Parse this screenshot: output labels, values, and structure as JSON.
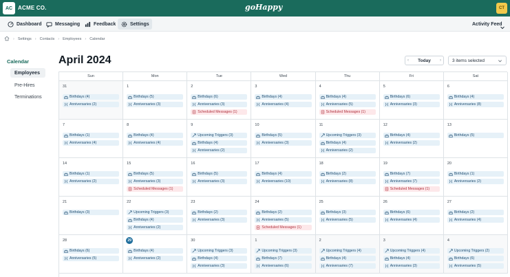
{
  "org": {
    "badge": "AC",
    "name": "ACME CO."
  },
  "brand": "goHappy",
  "user": {
    "initials": "CT"
  },
  "nav": {
    "items": [
      {
        "name": "dashboard",
        "label": "Dashboard",
        "icon": "dashboard-icon"
      },
      {
        "name": "messaging",
        "label": "Messaging",
        "icon": "message-icon"
      },
      {
        "name": "feedback",
        "label": "Feedback",
        "icon": "chart-icon"
      },
      {
        "name": "settings",
        "label": "Settings",
        "icon": "gear-icon",
        "active": true
      }
    ],
    "activity_feed": "Activity Feed"
  },
  "breadcrumbs": [
    "Settings",
    "Contacts",
    "Employees",
    "Calendar"
  ],
  "sidebar": {
    "title": "Calendar",
    "items": [
      {
        "label": "Employees",
        "active": true
      },
      {
        "label": "Pre-Hires"
      },
      {
        "label": "Terminations"
      }
    ]
  },
  "calendar": {
    "title": "April 2024",
    "today_label": "Today",
    "prev_glyph": "‹",
    "next_glyph": "›",
    "filter_label": "3 items selected",
    "weekdays": [
      "Sun",
      "Mon",
      "Tue",
      "Wed",
      "Thu",
      "Fri",
      "Sat"
    ],
    "weeks": [
      [
        {
          "day": "31",
          "outside": true,
          "events": [
            {
              "type": "birthdays",
              "label": "Birthdays (4)"
            },
            {
              "type": "anniversaries",
              "label": "Anniversaries (2)"
            }
          ]
        },
        {
          "day": "1",
          "events": [
            {
              "type": "birthdays",
              "label": "Birthdays (5)"
            },
            {
              "type": "anniversaries",
              "label": "Anniversaries (3)"
            }
          ]
        },
        {
          "day": "2",
          "events": [
            {
              "type": "birthdays",
              "label": "Birthdays (6)"
            },
            {
              "type": "anniversaries",
              "label": "Anniversaries (3)"
            },
            {
              "type": "scheduled",
              "label": "Scheduled Messages (1)"
            }
          ]
        },
        {
          "day": "3",
          "events": [
            {
              "type": "birthdays",
              "label": "Birthdays (4)"
            },
            {
              "type": "anniversaries",
              "label": "Anniversaries (4)"
            }
          ]
        },
        {
          "day": "4",
          "events": [
            {
              "type": "birthdays",
              "label": "Birthdays (4)"
            },
            {
              "type": "anniversaries",
              "label": "Anniversaries (5)"
            },
            {
              "type": "scheduled",
              "label": "Scheduled Messages (1)"
            }
          ]
        },
        {
          "day": "5",
          "events": [
            {
              "type": "birthdays",
              "label": "Birthdays (6)"
            },
            {
              "type": "anniversaries",
              "label": "Anniversaries (3)"
            }
          ]
        },
        {
          "day": "6",
          "events": [
            {
              "type": "birthdays",
              "label": "Birthdays (4)"
            },
            {
              "type": "anniversaries",
              "label": "Anniversaries (8)"
            }
          ]
        }
      ],
      [
        {
          "day": "7",
          "events": [
            {
              "type": "birthdays",
              "label": "Birthdays (1)"
            },
            {
              "type": "anniversaries",
              "label": "Anniversaries (4)"
            }
          ]
        },
        {
          "day": "8",
          "events": [
            {
              "type": "birthdays",
              "label": "Birthdays (4)"
            },
            {
              "type": "anniversaries",
              "label": "Anniversaries (4)"
            }
          ]
        },
        {
          "day": "9",
          "events": [
            {
              "type": "triggers",
              "label": "Upcoming Triggers (3)"
            },
            {
              "type": "birthdays",
              "label": "Birthdays (4)"
            },
            {
              "type": "anniversaries",
              "label": "Anniversaries (2)"
            }
          ]
        },
        {
          "day": "10",
          "events": [
            {
              "type": "birthdays",
              "label": "Birthdays (5)"
            },
            {
              "type": "anniversaries",
              "label": "Anniversaries (3)"
            }
          ]
        },
        {
          "day": "11",
          "events": [
            {
              "type": "triggers",
              "label": "Upcoming Triggers (3)"
            },
            {
              "type": "birthdays",
              "label": "Birthdays (4)"
            },
            {
              "type": "anniversaries",
              "label": "Anniversaries (2)"
            }
          ]
        },
        {
          "day": "12",
          "events": [
            {
              "type": "birthdays",
              "label": "Birthdays (4)"
            },
            {
              "type": "anniversaries",
              "label": "Anniversaries (2)"
            }
          ]
        },
        {
          "day": "13",
          "events": [
            {
              "type": "birthdays",
              "label": "Birthdays (5)"
            }
          ]
        }
      ],
      [
        {
          "day": "14",
          "events": [
            {
              "type": "birthdays",
              "label": "Birthdays (1)"
            },
            {
              "type": "anniversaries",
              "label": "Anniversaries (2)"
            }
          ]
        },
        {
          "day": "15",
          "events": [
            {
              "type": "birthdays",
              "label": "Birthdays (5)"
            },
            {
              "type": "anniversaries",
              "label": "Anniversaries (3)"
            },
            {
              "type": "scheduled",
              "label": "Scheduled Messages (1)"
            }
          ]
        },
        {
          "day": "16",
          "events": [
            {
              "type": "birthdays",
              "label": "Birthdays (5)"
            },
            {
              "type": "anniversaries",
              "label": "Anniversaries (3)"
            }
          ]
        },
        {
          "day": "17",
          "events": [
            {
              "type": "birthdays",
              "label": "Birthdays (4)"
            },
            {
              "type": "anniversaries",
              "label": "Anniversaries (10)"
            }
          ]
        },
        {
          "day": "18",
          "events": [
            {
              "type": "birthdays",
              "label": "Birthdays (2)"
            },
            {
              "type": "anniversaries",
              "label": "Anniversaries (8)"
            }
          ]
        },
        {
          "day": "19",
          "events": [
            {
              "type": "birthdays",
              "label": "Birthdays (7)"
            },
            {
              "type": "anniversaries",
              "label": "Anniversaries (7)"
            },
            {
              "type": "scheduled",
              "label": "Scheduled Messages (1)"
            }
          ]
        },
        {
          "day": "20",
          "events": [
            {
              "type": "birthdays",
              "label": "Birthdays (1)"
            },
            {
              "type": "anniversaries",
              "label": "Anniversaries (2)"
            }
          ]
        }
      ],
      [
        {
          "day": "21",
          "events": [
            {
              "type": "birthdays",
              "label": "Birthdays (3)"
            }
          ]
        },
        {
          "day": "22",
          "events": [
            {
              "type": "triggers",
              "label": "Upcoming Triggers (3)"
            },
            {
              "type": "birthdays",
              "label": "Birthdays (4)"
            },
            {
              "type": "anniversaries",
              "label": "Anniversaries (2)"
            }
          ]
        },
        {
          "day": "23",
          "events": [
            {
              "type": "birthdays",
              "label": "Birthdays (2)"
            },
            {
              "type": "anniversaries",
              "label": "Anniversaries (3)"
            }
          ]
        },
        {
          "day": "24",
          "events": [
            {
              "type": "birthdays",
              "label": "Birthdays (2)"
            },
            {
              "type": "anniversaries",
              "label": "Anniversaries (5)"
            },
            {
              "type": "scheduled",
              "label": "Scheduled Messages (1)"
            }
          ]
        },
        {
          "day": "25",
          "events": [
            {
              "type": "birthdays",
              "label": "Birthdays (3)"
            },
            {
              "type": "anniversaries",
              "label": "Anniversaries (5)"
            }
          ]
        },
        {
          "day": "26",
          "events": [
            {
              "type": "birthdays",
              "label": "Birthdays (6)"
            },
            {
              "type": "anniversaries",
              "label": "Anniversaries (4)"
            }
          ]
        },
        {
          "day": "27",
          "events": [
            {
              "type": "birthdays",
              "label": "Birthdays (2)"
            },
            {
              "type": "anniversaries",
              "label": "Anniversaries (4)"
            }
          ]
        }
      ],
      [
        {
          "day": "28",
          "events": [
            {
              "type": "birthdays",
              "label": "Birthdays (6)"
            },
            {
              "type": "anniversaries",
              "label": "Anniversaries (5)"
            }
          ]
        },
        {
          "day": "29",
          "today": true,
          "events": [
            {
              "type": "birthdays",
              "label": "Birthdays (4)"
            },
            {
              "type": "anniversaries",
              "label": "Anniversaries (2)"
            }
          ]
        },
        {
          "day": "30",
          "events": [
            {
              "type": "triggers",
              "label": "Upcoming Triggers (3)"
            },
            {
              "type": "birthdays",
              "label": "Birthdays (4)"
            },
            {
              "type": "anniversaries",
              "label": "Anniversaries (3)"
            }
          ]
        },
        {
          "day": "1",
          "outside": true,
          "events": [
            {
              "type": "triggers",
              "label": "Upcoming Triggers (3)"
            },
            {
              "type": "birthdays",
              "label": "Birthdays (7)"
            },
            {
              "type": "anniversaries",
              "label": "Anniversaries (6)"
            }
          ]
        },
        {
          "day": "2",
          "outside": true,
          "events": [
            {
              "type": "triggers",
              "label": "Upcoming Triggers (4)"
            },
            {
              "type": "birthdays",
              "label": "Birthdays (4)"
            },
            {
              "type": "anniversaries",
              "label": "Anniversaries (7)"
            }
          ]
        },
        {
          "day": "3",
          "outside": true,
          "events": [
            {
              "type": "triggers",
              "label": "Upcoming Triggers (4)"
            },
            {
              "type": "birthdays",
              "label": "Birthdays (4)"
            },
            {
              "type": "anniversaries",
              "label": "Anniversaries (3)"
            }
          ]
        },
        {
          "day": "4",
          "outside": true,
          "events": [
            {
              "type": "triggers",
              "label": "Upcoming Triggers (2)"
            },
            {
              "type": "birthdays",
              "label": "Birthdays (6)"
            },
            {
              "type": "anniversaries",
              "label": "Anniversaries (5)"
            }
          ]
        }
      ]
    ]
  },
  "colors": {
    "brand_green": "#1a6b5c",
    "chip_blue": "#e6f1f8",
    "chip_red": "#fde8ea",
    "today_blue": "#1f6e9c"
  }
}
